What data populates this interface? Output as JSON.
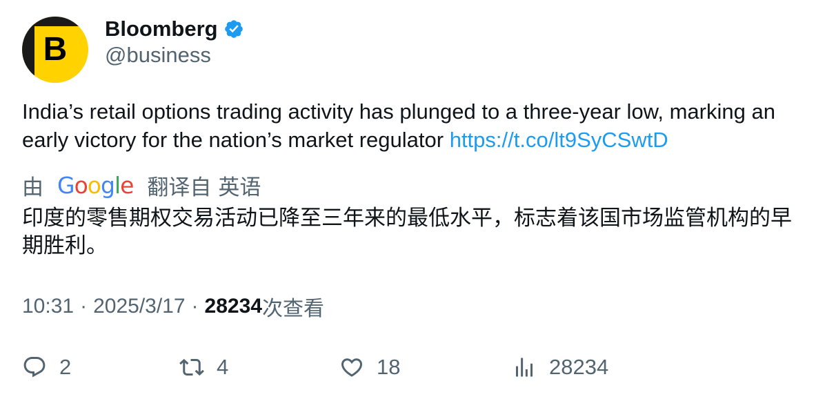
{
  "author": {
    "avatar_letter": "B",
    "display_name": "Bloomberg",
    "handle": "@business",
    "verified": true
  },
  "tweet": {
    "text": "India’s retail options trading activity has plunged to a three-year low, marking an early victory for the nation’s market regulator ",
    "link": "https://t.co/lt9SyCSwtD"
  },
  "translation": {
    "prefix": "由",
    "provider": "Google",
    "label": "翻译自",
    "language": "英语",
    "text": "印度的零售期权交易活动已降至三年来的最低水平，标志着该国市场监管机构的早期胜利。"
  },
  "meta": {
    "time": "10:31",
    "separator": "·",
    "date": "2025/3/17",
    "views": "28234",
    "views_label": "次查看"
  },
  "actions": {
    "replies": "2",
    "retweets": "4",
    "likes": "18",
    "views": "28234"
  },
  "colors": {
    "link": "#1d9bf0",
    "secondary_text": "#536471",
    "verified": "#1d9bf0",
    "avatar_bg": "#ffd200"
  }
}
